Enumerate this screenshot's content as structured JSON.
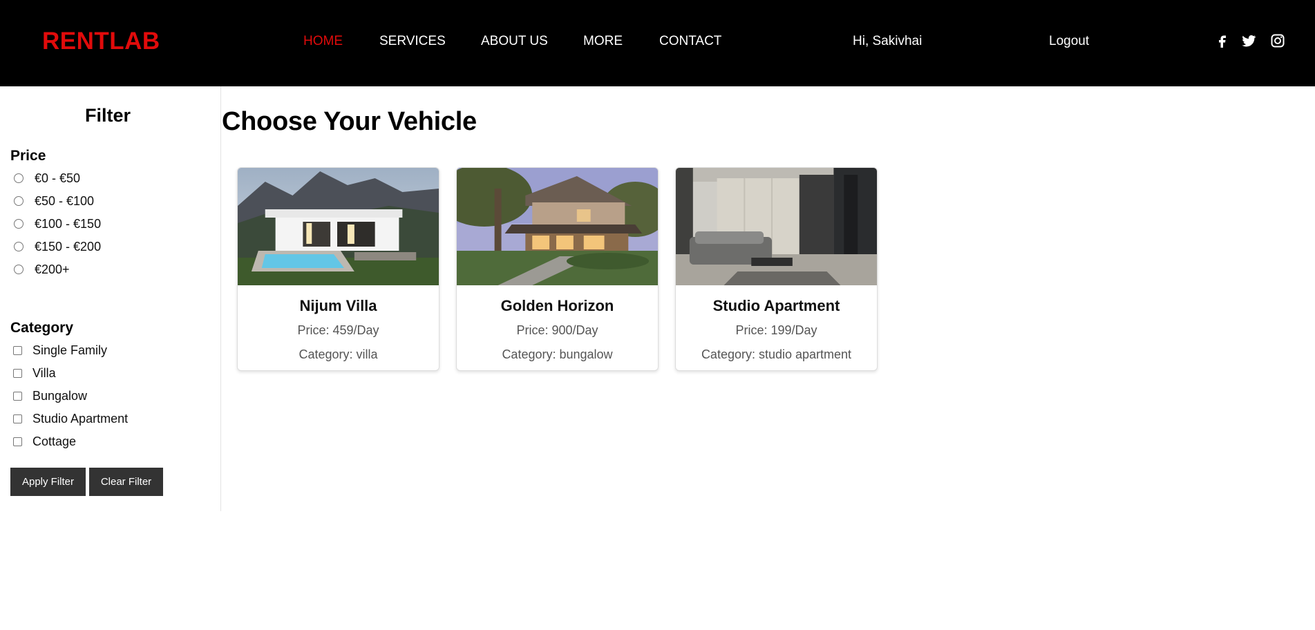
{
  "nav": {
    "brand": "RENTLAB",
    "links": [
      {
        "label": "HOME",
        "active": true
      },
      {
        "label": "SERVICES",
        "active": false
      },
      {
        "label": "ABOUT US",
        "active": false
      },
      {
        "label": "MORE",
        "active": false
      },
      {
        "label": "CONTACT",
        "active": false
      }
    ],
    "greeting": "Hi, Sakivhai",
    "logout": "Logout",
    "social_icons": [
      "facebook-icon",
      "twitter-icon",
      "instagram-icon"
    ]
  },
  "filter": {
    "title": "Filter",
    "price_title": "Price",
    "price_options": [
      "€0 - €50",
      "€50 - €100",
      "€100 - €150",
      "€150 - €200",
      "€200+"
    ],
    "category_title": "Category",
    "category_options": [
      "Single Family",
      "Villa",
      "Bungalow",
      "Studio Apartment",
      "Cottage"
    ],
    "apply_label": "Apply Filter",
    "clear_label": "Clear Filter"
  },
  "main": {
    "title": "Choose Your Vehicle",
    "listings": [
      {
        "name": "Nijum Villa",
        "price": "Price: 459/Day",
        "category": "Category: villa"
      },
      {
        "name": "Golden Horizon",
        "price": "Price: 900/Day",
        "category": "Category: bungalow"
      },
      {
        "name": "Studio Apartment",
        "price": "Price: 199/Day",
        "category": "Category: studio apartment"
      }
    ]
  },
  "colors": {
    "nav_bg": "#000000",
    "brand": "#e10b0b",
    "active_link": "#e10b0b",
    "button_bg": "#333333"
  }
}
